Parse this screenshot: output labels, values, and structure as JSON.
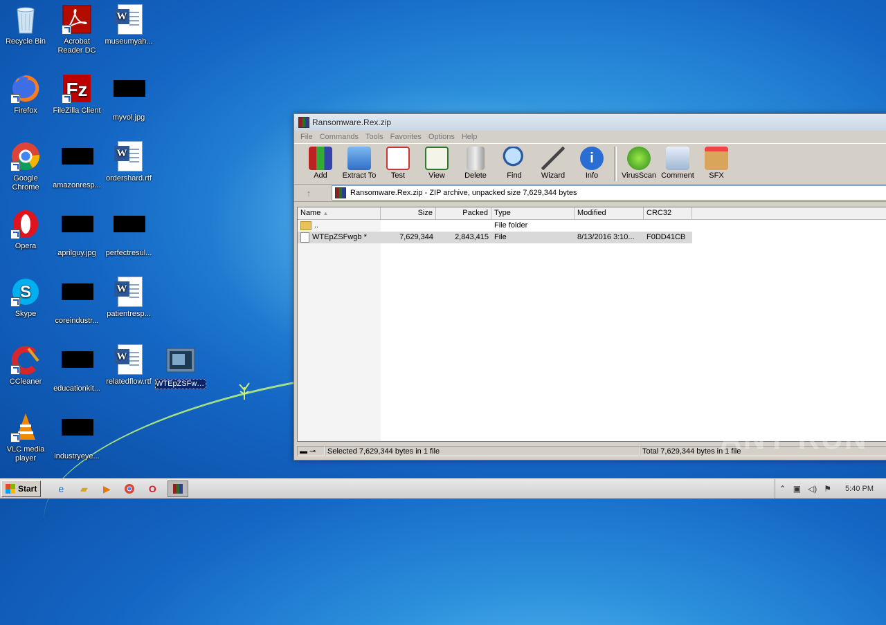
{
  "desktop": {
    "icons": [
      {
        "label": "Recycle Bin"
      },
      {
        "label": "Acrobat Reader DC"
      },
      {
        "label": "museumyah..."
      },
      {
        "label": "Firefox"
      },
      {
        "label": "FileZilla Client"
      },
      {
        "label": "myvol.jpg"
      },
      {
        "label": "Google Chrome"
      },
      {
        "label": "amazonresp..."
      },
      {
        "label": "ordershard.rtf"
      },
      {
        "label": "Opera"
      },
      {
        "label": "aprilguy.jpg"
      },
      {
        "label": "perfectresul..."
      },
      {
        "label": "Skype"
      },
      {
        "label": "coreindustr..."
      },
      {
        "label": "patientresp..."
      },
      {
        "label": "CCleaner"
      },
      {
        "label": "educationkit..."
      },
      {
        "label": "relatedflow.rtf"
      },
      {
        "label": "WTEpZSFwgb.exe"
      },
      {
        "label": "VLC media player"
      },
      {
        "label": "industryeye..."
      }
    ]
  },
  "window": {
    "title": "Ransomware.Rex.zip",
    "menu": [
      "File",
      "Commands",
      "Tools",
      "Favorites",
      "Options",
      "Help"
    ],
    "toolbar": [
      "Add",
      "Extract To",
      "Test",
      "View",
      "Delete",
      "Find",
      "Wizard",
      "Info",
      "VirusScan",
      "Comment",
      "SFX"
    ],
    "address": "Ransomware.Rex.zip - ZIP archive, unpacked size 7,629,344 bytes",
    "columns": [
      "Name",
      "Size",
      "Packed",
      "Type",
      "Modified",
      "CRC32"
    ],
    "rows": [
      {
        "name": "..",
        "size": "",
        "packed": "",
        "type": "File folder",
        "modified": "",
        "crc": ""
      },
      {
        "name": "WTEpZSFwgb *",
        "size": "7,629,344",
        "packed": "2,843,415",
        "type": "File",
        "modified": "8/13/2016 3:10...",
        "crc": "F0DD41CB"
      }
    ],
    "status_left": "Selected 7,629,344 bytes in 1 file",
    "status_right": "Total 7,629,344 bytes in 1 file"
  },
  "taskbar": {
    "start": "Start",
    "clock": "5:40 PM"
  },
  "watermark": "ANY RUN"
}
